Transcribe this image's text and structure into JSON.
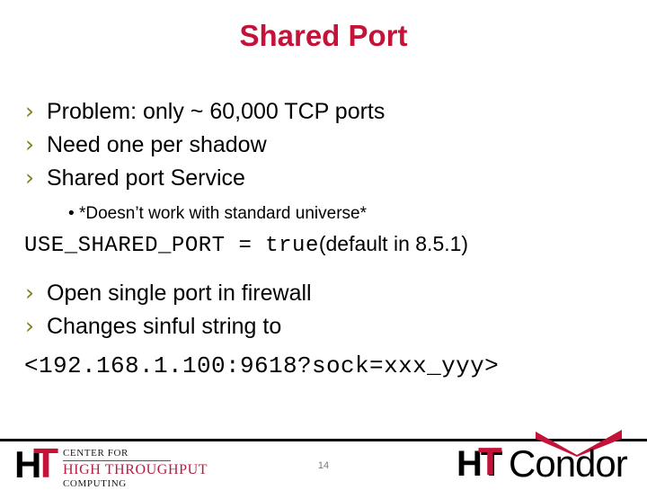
{
  "slide": {
    "title": "Shared Port",
    "page_number": "14",
    "title_color": "#C41239",
    "bullet_color": "#7F7F17",
    "accent_red": "#C41239"
  },
  "bullets": [
    {
      "marker": "›",
      "text": "Problem:  only ~ 60,000 TCP ports"
    },
    {
      "marker": "›",
      "text": "Need one per shadow"
    },
    {
      "marker": "›",
      "text": "Shared port Service"
    }
  ],
  "subbullet": {
    "marker": "•",
    "text": "*Doesn’t work with standard universe*"
  },
  "config_line": {
    "code": "USE_SHARED_PORT = true",
    "note": "(default in 8.5.1)"
  },
  "bullets2": [
    {
      "marker": "›",
      "text": "Open single port in firewall"
    },
    {
      "marker": "›",
      "text": "Changes sinful string to"
    }
  ],
  "sinful_string": "<192.168.1.100:9618?sock=xxx_yyy>",
  "chtc_logo": {
    "mark_h": "H",
    "mark_t": "T",
    "line1": "CENTER FOR",
    "line2": "HIGH THROUGHPUT",
    "line3": "COMPUTING"
  },
  "htcondor_logo": {
    "ht": "HT",
    "t_overlay": "T",
    "condor": "Condor"
  }
}
